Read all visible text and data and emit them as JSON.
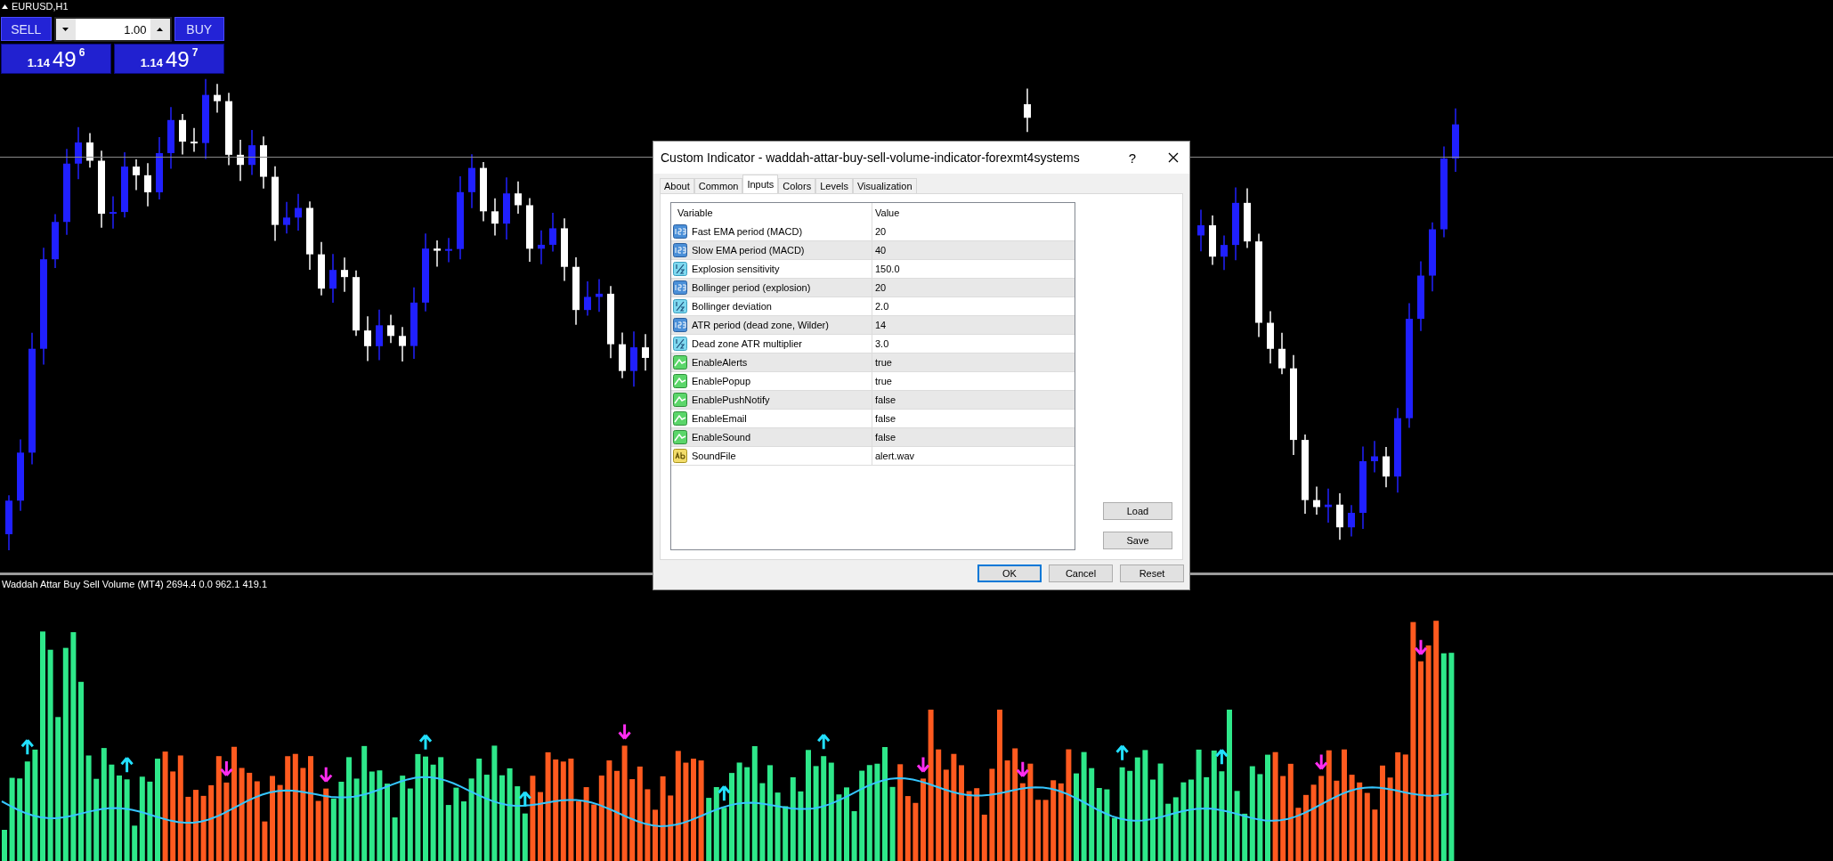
{
  "chart": {
    "symbol": "EURUSD,H1",
    "indicator_label": "Waddah Attar Buy Sell Volume (MT4) 2694.4 0.0 962.1 419.1"
  },
  "trade_panel": {
    "sell": {
      "label": "SELL",
      "price_prefix": "1.14",
      "price_main": "49",
      "price_sup": "6"
    },
    "lot": {
      "value": "1.00"
    },
    "buy": {
      "label": "BUY",
      "price_prefix": "1.14",
      "price_main": "49",
      "price_sup": "7"
    }
  },
  "dialog": {
    "title": "Custom Indicator - waddah-attar-buy-sell-volume-indicator-forexmt4systems",
    "help": "?",
    "tabs": [
      {
        "label": "About",
        "selected": false
      },
      {
        "label": "Common",
        "selected": false
      },
      {
        "label": "Inputs",
        "selected": true
      },
      {
        "label": "Colors",
        "selected": false
      },
      {
        "label": "Levels",
        "selected": false
      },
      {
        "label": "Visualization",
        "selected": false
      }
    ],
    "columns": [
      "Variable",
      "Value"
    ],
    "rows": [
      {
        "kind": "integer",
        "variable": "Fast EMA period (MACD)",
        "value": "20"
      },
      {
        "kind": "integer",
        "variable": "Slow EMA period (MACD)",
        "value": "40"
      },
      {
        "kind": "fraction",
        "variable": "Explosion sensitivity",
        "value": "150.0"
      },
      {
        "kind": "integer",
        "variable": "Bollinger period (explosion)",
        "value": "20"
      },
      {
        "kind": "fraction",
        "variable": "Bollinger deviation",
        "value": "2.0"
      },
      {
        "kind": "integer",
        "variable": "ATR period (dead zone, Wilder)",
        "value": "14"
      },
      {
        "kind": "fraction",
        "variable": "Dead zone ATR multiplier",
        "value": "3.0"
      },
      {
        "kind": "toggle",
        "variable": "EnableAlerts",
        "value": "true"
      },
      {
        "kind": "toggle",
        "variable": "EnablePopup",
        "value": "true"
      },
      {
        "kind": "toggle",
        "variable": "EnablePushNotify",
        "value": "false"
      },
      {
        "kind": "toggle",
        "variable": "EnableEmail",
        "value": "false"
      },
      {
        "kind": "toggle",
        "variable": "EnableSound",
        "value": "false"
      },
      {
        "kind": "text",
        "variable": "SoundFile",
        "value": "alert.wav"
      }
    ],
    "side_buttons": [
      "Load",
      "Save"
    ],
    "buttons": [
      {
        "label": "OK",
        "default": true
      },
      {
        "label": "Cancel",
        "default": false
      },
      {
        "label": "Reset",
        "default": false
      }
    ]
  }
}
